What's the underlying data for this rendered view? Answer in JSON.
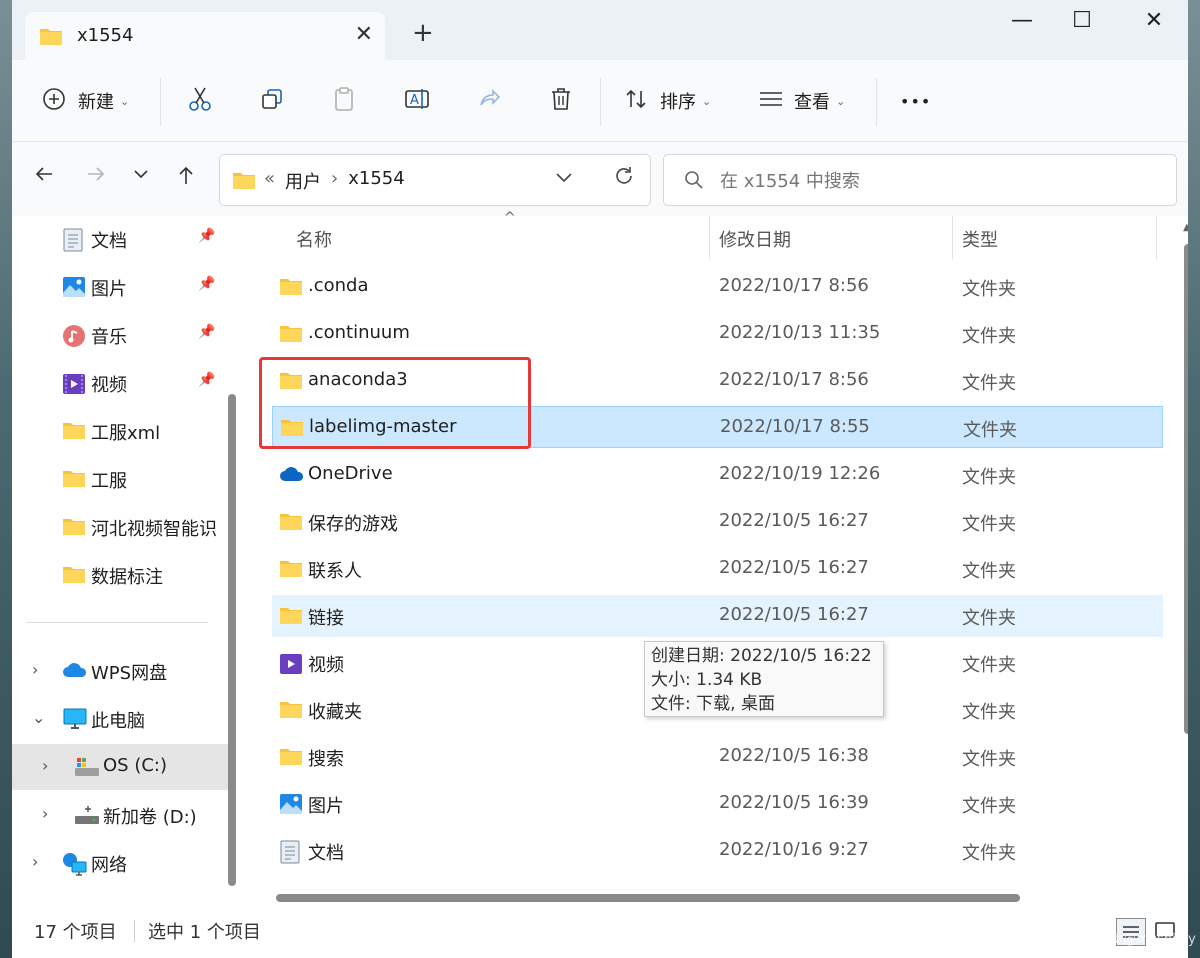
{
  "window": {
    "tab_title": "x1554",
    "new_tab": "+",
    "close_tab": "✕",
    "minimize": "—",
    "maximize": "☐",
    "close": "✕"
  },
  "toolbar": {
    "new_label": "新建",
    "sort_label": "排序",
    "view_label": "查看",
    "more_label": "•••"
  },
  "address": {
    "overflow": "«",
    "crumbs": [
      "用户",
      "x1554"
    ],
    "separator": "›"
  },
  "search": {
    "placeholder": "在 x1554 中搜索"
  },
  "sidebar": {
    "items": [
      {
        "label": "文档",
        "icon": "document-icon",
        "pinned": true
      },
      {
        "label": "图片",
        "icon": "pictures-icon",
        "pinned": true
      },
      {
        "label": "音乐",
        "icon": "music-icon",
        "pinned": true
      },
      {
        "label": "视频",
        "icon": "video-icon",
        "pinned": true
      },
      {
        "label": "工服xml",
        "icon": "folder-icon",
        "pinned": false
      },
      {
        "label": "工服",
        "icon": "folder-icon",
        "pinned": false
      },
      {
        "label": "河北视频智能识",
        "icon": "folder-icon",
        "pinned": false
      },
      {
        "label": "数据标注",
        "icon": "folder-icon",
        "pinned": false
      }
    ],
    "tree": [
      {
        "label": "WPS网盘",
        "icon": "cloud-icon",
        "expanded": false
      },
      {
        "label": "此电脑",
        "icon": "computer-icon",
        "expanded": true
      },
      {
        "label": "OS (C:)",
        "icon": "drive-icon",
        "expanded": false,
        "selected": true
      },
      {
        "label": "新加卷 (D:)",
        "icon": "drive-icon",
        "expanded": false
      },
      {
        "label": "网络",
        "icon": "network-icon",
        "expanded": false
      }
    ]
  },
  "columns": {
    "name": "名称",
    "date": "修改日期",
    "type": "类型"
  },
  "files": [
    {
      "name": ".conda",
      "date": "2022/10/17 8:56",
      "type": "文件夹",
      "icon": "folder-icon"
    },
    {
      "name": ".continuum",
      "date": "2022/10/13 11:35",
      "type": "文件夹",
      "icon": "folder-icon"
    },
    {
      "name": "anaconda3",
      "date": "2022/10/17 8:56",
      "type": "文件夹",
      "icon": "folder-icon"
    },
    {
      "name": "labelimg-master",
      "date": "2022/10/17 8:55",
      "type": "文件夹",
      "icon": "folder-icon",
      "selected": true
    },
    {
      "name": "OneDrive",
      "date": "2022/10/19 12:26",
      "type": "文件夹",
      "icon": "onedrive-icon"
    },
    {
      "name": "保存的游戏",
      "date": "2022/10/5 16:27",
      "type": "文件夹",
      "icon": "folder-icon"
    },
    {
      "name": "联系人",
      "date": "2022/10/5 16:27",
      "type": "文件夹",
      "icon": "folder-icon"
    },
    {
      "name": "链接",
      "date": "2022/10/5 16:27",
      "type": "文件夹",
      "icon": "folder-icon",
      "hover": true
    },
    {
      "name": "视频",
      "date": "",
      "type": "文件夹",
      "icon": "video-icon"
    },
    {
      "name": "收藏夹",
      "date": "",
      "type": "文件夹",
      "icon": "folder-icon"
    },
    {
      "name": "搜索",
      "date": "2022/10/5 16:38",
      "type": "文件夹",
      "icon": "folder-icon"
    },
    {
      "name": "图片",
      "date": "2022/10/5 16:39",
      "type": "文件夹",
      "icon": "pictures-icon"
    },
    {
      "name": "文档",
      "date": "2022/10/16 9:27",
      "type": "文件夹",
      "icon": "document-icon"
    }
  ],
  "tooltip": {
    "created": "创建日期: 2022/10/5 16:22",
    "size": "大小: 1.34 KB",
    "files": "文件: 下载, 桌面"
  },
  "status": {
    "count": "17 个项目",
    "selected": "选中 1 个项目"
  },
  "watermark": "CSDN @mushi-xy",
  "colors": {
    "accent": "#0067c0",
    "selection": "#cce8ff",
    "highlight_box": "#e53935",
    "folder": "#f8c33a"
  }
}
